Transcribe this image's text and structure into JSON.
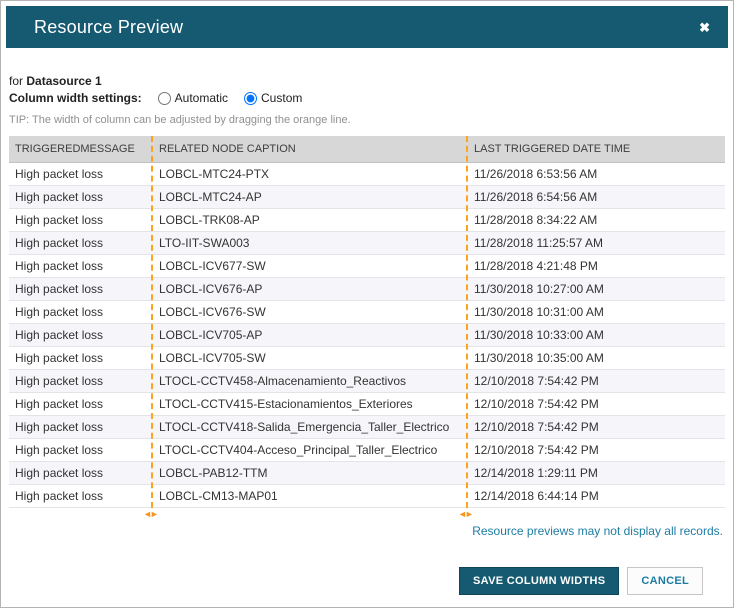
{
  "modal": {
    "title": "Resource Preview",
    "close_icon": "✖"
  },
  "subheader": {
    "for_label": "for",
    "datasource": "Datasource 1"
  },
  "settings": {
    "label": "Column width settings:",
    "options": [
      {
        "label": "Automatic",
        "selected": false
      },
      {
        "label": "Custom",
        "selected": true
      }
    ]
  },
  "tip": "TIP: The width of column can be adjusted by dragging the orange line.",
  "table": {
    "columns": [
      "TRIGGEREDMESSAGE",
      "RELATED NODE CAPTION",
      "LAST TRIGGERED DATE TIME"
    ],
    "divider_handle": "◄►",
    "rows": [
      [
        "High packet loss",
        "LOBCL-MTC24-PTX",
        "11/26/2018 6:53:56 AM"
      ],
      [
        "High packet loss",
        "LOBCL-MTC24-AP",
        "11/26/2018 6:54:56 AM"
      ],
      [
        "High packet loss",
        "LOBCL-TRK08-AP",
        "11/28/2018 8:34:22 AM"
      ],
      [
        "High packet loss",
        "LTO-IIT-SWA003",
        "11/28/2018 11:25:57 AM"
      ],
      [
        "High packet loss",
        "LOBCL-ICV677-SW",
        "11/28/2018 4:21:48 PM"
      ],
      [
        "High packet loss",
        "LOBCL-ICV676-AP",
        "11/30/2018 10:27:00 AM"
      ],
      [
        "High packet loss",
        "LOBCL-ICV676-SW",
        "11/30/2018 10:31:00 AM"
      ],
      [
        "High packet loss",
        "LOBCL-ICV705-AP",
        "11/30/2018 10:33:00 AM"
      ],
      [
        "High packet loss",
        "LOBCL-ICV705-SW",
        "11/30/2018 10:35:00 AM"
      ],
      [
        "High packet loss",
        "LTOCL-CCTV458-Almacenamiento_Reactivos",
        "12/10/2018 7:54:42 PM"
      ],
      [
        "High packet loss",
        "LTOCL-CCTV415-Estacionamientos_Exteriores",
        "12/10/2018 7:54:42 PM"
      ],
      [
        "High packet loss",
        "LTOCL-CCTV418-Salida_Emergencia_Taller_Electrico",
        "12/10/2018 7:54:42 PM"
      ],
      [
        "High packet loss",
        "LTOCL-CCTV404-Acceso_Principal_Taller_Electrico",
        "12/10/2018 7:54:42 PM"
      ],
      [
        "High packet loss",
        "LOBCL-PAB12-TTM",
        "12/14/2018 1:29:11 PM"
      ],
      [
        "High packet loss",
        "LOBCL-CM13-MAP01",
        "12/14/2018 6:44:14 PM"
      ]
    ]
  },
  "footer_note": "Resource previews may not display all records.",
  "buttons": {
    "save": "SAVE COLUMN WIDTHS",
    "cancel": "CANCEL"
  },
  "colors": {
    "header_bg": "#155a71",
    "accent_orange": "#ffa21f",
    "link_text": "#1d7ca3",
    "table_header_bg": "#d7d7d7"
  }
}
